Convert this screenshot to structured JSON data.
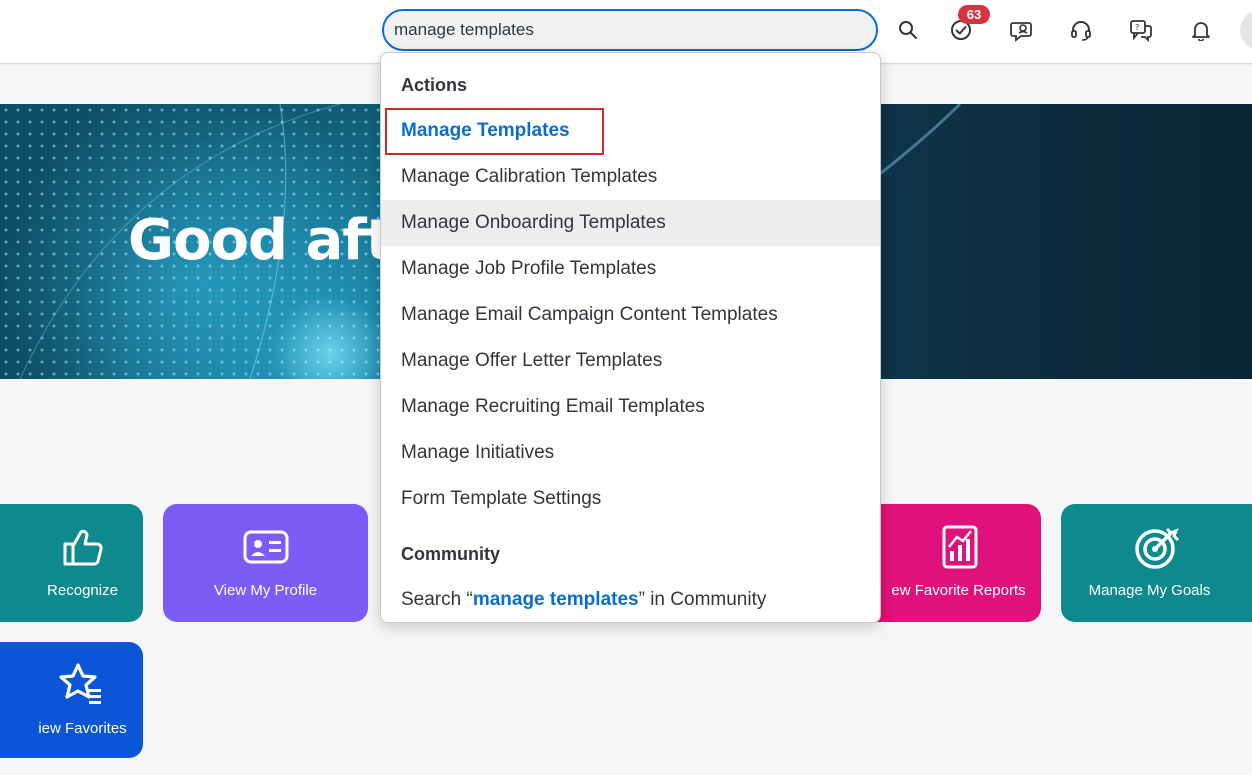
{
  "header": {
    "search_value": "manage templates",
    "notification_count": "63",
    "icons": [
      "search-icon",
      "todo-check-icon",
      "chat-bot-icon",
      "headset-icon",
      "feedback-icon",
      "bell-icon"
    ]
  },
  "banner": {
    "greeting": "Good aft"
  },
  "tiles": [
    {
      "label": "Recognize",
      "color": "#0e8a8f",
      "icon": "thumbs-up-icon"
    },
    {
      "label": "View My Profile",
      "color": "#7b5cf5",
      "icon": "id-card-icon"
    },
    {
      "label": "ew Favorite Reports",
      "color": "#e0117a",
      "icon": "report-icon"
    },
    {
      "label": "Manage My Goals",
      "color": "#0e8a8f",
      "icon": "target-icon"
    },
    {
      "label": "iew Favorites",
      "color": "#0b55d6",
      "icon": "star-list-icon"
    }
  ],
  "dropdown": {
    "actions_title": "Actions",
    "items": [
      "Manage Templates",
      "Manage Calibration Templates",
      "Manage Onboarding Templates",
      "Manage Job Profile Templates",
      "Manage Email Campaign Content Templates",
      "Manage Offer Letter Templates",
      "Manage Recruiting Email Templates",
      "Manage Initiatives",
      "Form Template Settings"
    ],
    "community_title": "Community",
    "community_search": {
      "prefix": "Search “",
      "keyword": "manage templates",
      "suffix": "” in Community"
    }
  },
  "colors": {
    "accent": "#0a6ed1",
    "badge": "#d6343e",
    "highlight_border": "#d02b2b"
  }
}
